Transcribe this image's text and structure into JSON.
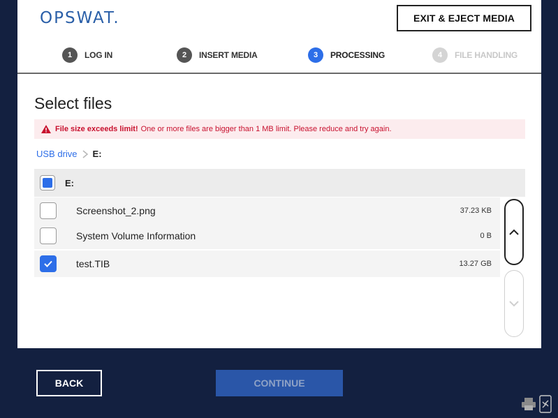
{
  "header": {
    "logo": "OPSWAT.",
    "eject_label": "EXIT & EJECT MEDIA",
    "steps": [
      {
        "num": "1",
        "label": "LOG IN",
        "state": "done"
      },
      {
        "num": "2",
        "label": "INSERT MEDIA",
        "state": "done"
      },
      {
        "num": "3",
        "label": "PROCESSING",
        "state": "active"
      },
      {
        "num": "4",
        "label": "FILE HANDLING",
        "state": "future"
      }
    ]
  },
  "main": {
    "title": "Select files",
    "error": {
      "bold": "File size exceeds limit!",
      "text": "One or more files are bigger than 1 MB limit. Please reduce and try again."
    },
    "breadcrumb": {
      "root": "USB drive",
      "current": "E:"
    },
    "list_header": "E:",
    "files": [
      {
        "name": "Screenshot_2.png",
        "size": "37.23 KB",
        "checked": false
      },
      {
        "name": "System Volume Information",
        "size": "0 B",
        "checked": false
      },
      {
        "name": "test.TIB",
        "size": "13.27 GB",
        "checked": true
      }
    ]
  },
  "footer": {
    "back_label": "BACK",
    "continue_label": "CONTINUE"
  },
  "colors": {
    "accent": "#2d6ee8",
    "background": "#132040",
    "error": "#c8102e",
    "continue_disabled": "#2a56a8"
  }
}
